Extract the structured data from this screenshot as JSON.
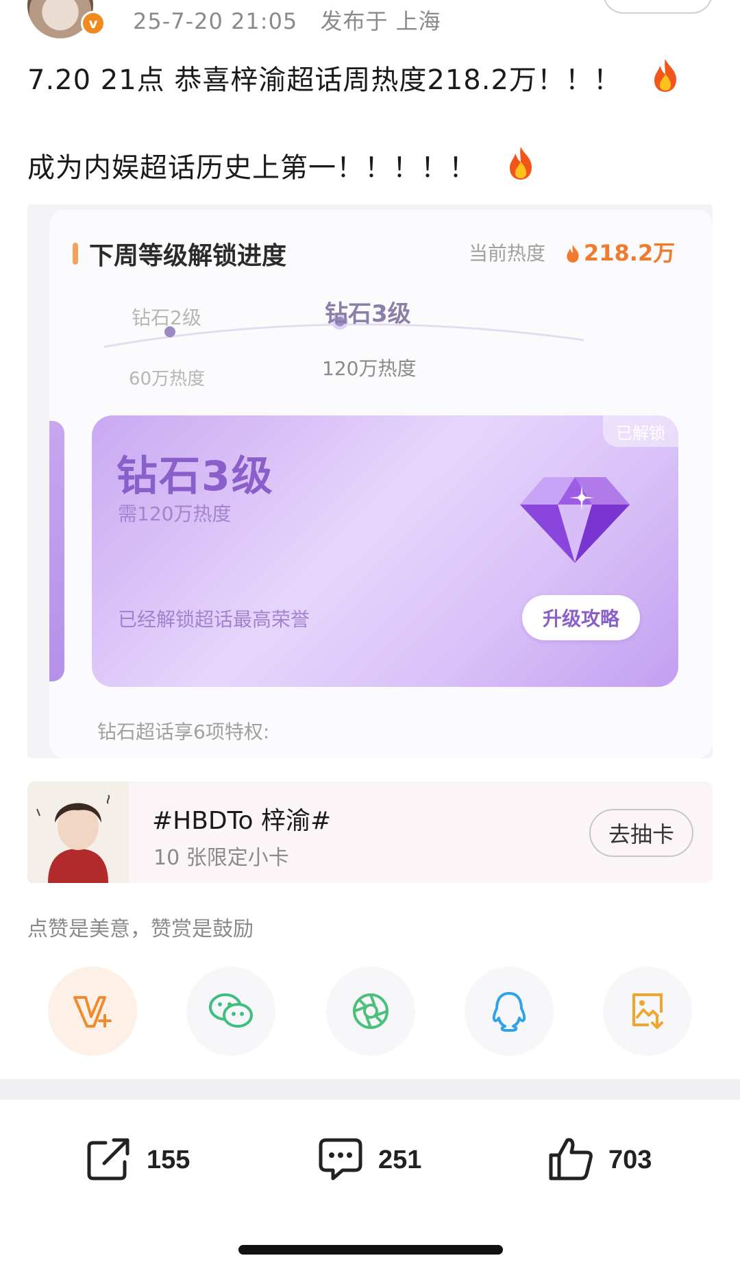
{
  "post": {
    "timestamp": "25-7-20 21:05",
    "location": "发布于 上海",
    "verified_badge": "v",
    "line1": "7.20 21点 恭喜梓渝超话周热度218.2万！！！",
    "line2": "成为内娱超话历史上第一！！！！！",
    "emoji_icon": "fire-icon"
  },
  "screenshot": {
    "section_title": "下周等级解锁进度",
    "current_heat_label": "当前热度",
    "current_heat_value": "218.2万",
    "levels": [
      {
        "name": "钻石2级",
        "requirement": "60万热度"
      },
      {
        "name": "钻石3级",
        "requirement": "120万热度"
      }
    ],
    "card": {
      "title": "钻石3级",
      "requirement": "需120万热度",
      "status": "已解锁",
      "footer": "已经解锁超话最高荣誉",
      "button": "升级攻略"
    },
    "privilege_text": "钻石超话享6项特权:"
  },
  "topic": {
    "title": "#HBDTo 梓渝#",
    "subtitle": "10 张限定小卡",
    "button": "去抽卡"
  },
  "reward_text": "点赞是美意，赞赏是鼓励",
  "share_icons": [
    "vplus-icon",
    "wechat-icon",
    "moments-icon",
    "qq-icon",
    "save-image-icon"
  ],
  "actions": {
    "repost_count": "155",
    "comment_count": "251",
    "like_count": "703"
  },
  "colors": {
    "accent_orange": "#f07b2c",
    "card_purple": "#caa8f2",
    "wechat_green": "#3fbf7f",
    "qq_blue": "#2fa3e6"
  }
}
